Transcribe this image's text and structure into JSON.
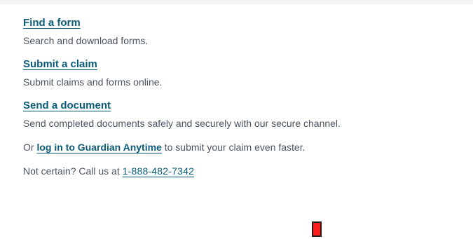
{
  "actions": [
    {
      "title": "Find a form",
      "description": "Search and download forms."
    },
    {
      "title": "Submit a claim",
      "description": "Submit claims and forms online."
    },
    {
      "title": "Send a document",
      "description": "Send completed documents safely and securely with our secure channel."
    }
  ],
  "login_line": {
    "prefix": "Or ",
    "link": "log in to Guardian Anytime",
    "suffix": " to submit your claim even faster."
  },
  "phone_line": {
    "prefix": "Not certain? Call us at ",
    "phone": "1-888-482-7342"
  },
  "colors": {
    "link": "#0a5c7a",
    "text": "#4a5561",
    "marker": "#ff1a1a"
  }
}
